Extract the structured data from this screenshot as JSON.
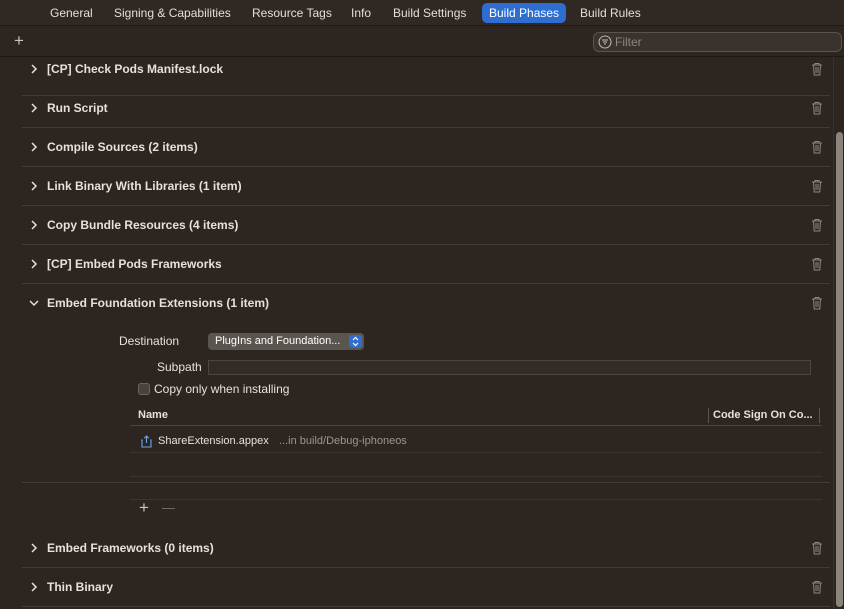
{
  "tabs": [
    {
      "label": "General",
      "active": false
    },
    {
      "label": "Signing & Capabilities",
      "active": false
    },
    {
      "label": "Resource Tags",
      "active": false
    },
    {
      "label": "Info",
      "active": false
    },
    {
      "label": "Build Settings",
      "active": false
    },
    {
      "label": "Build Phases",
      "active": true
    },
    {
      "label": "Build Rules",
      "active": false
    }
  ],
  "toolbar": {
    "add_icon": "plus-icon",
    "filter_placeholder": "Filter",
    "filter_icon": "filter-icon"
  },
  "phases": [
    {
      "title": "[CP] Check Pods Manifest.lock",
      "expanded": false
    },
    {
      "title": "Run Script",
      "expanded": false
    },
    {
      "title": "Compile Sources (2 items)",
      "expanded": false
    },
    {
      "title": "Link Binary With Libraries (1 item)",
      "expanded": false
    },
    {
      "title": "Copy Bundle Resources (4 items)",
      "expanded": false
    },
    {
      "title": "[CP] Embed Pods Frameworks",
      "expanded": false
    },
    {
      "title": "Embed Foundation Extensions (1 item)",
      "expanded": true
    },
    {
      "title": "Embed Frameworks (0 items)",
      "expanded": false
    },
    {
      "title": "Thin Binary",
      "expanded": false
    }
  ],
  "embed_extensions": {
    "destination_label": "Destination",
    "destination_value": "PlugIns and Foundation...",
    "subpath_label": "Subpath",
    "subpath_value": "",
    "copy_only_label": "Copy only when installing",
    "copy_only_checked": false,
    "columns": {
      "name": "Name",
      "code_sign": "Code Sign On Co..."
    },
    "files": [
      {
        "name": "ShareExtension.appex",
        "path": "...in build/Debug-iphoneos",
        "icon": "extension-icon"
      }
    ]
  },
  "colors": {
    "background": "#2d2520",
    "accent": "#2f6ed0",
    "text": "#e6e1dc",
    "separator": "#443b35"
  }
}
